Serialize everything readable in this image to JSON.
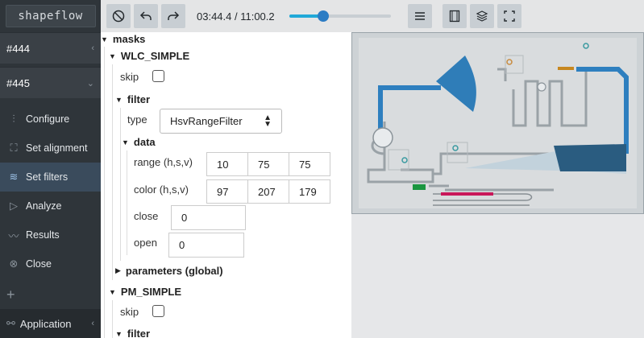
{
  "brand": "shapeflow",
  "feeds": [
    {
      "label": "#444"
    },
    {
      "label": "#445"
    }
  ],
  "nav": [
    {
      "label": "Configure",
      "icon": "sliders-icon"
    },
    {
      "label": "Set alignment",
      "icon": "align-icon"
    },
    {
      "label": "Set filters",
      "icon": "layers-icon",
      "active": true
    },
    {
      "label": "Analyze",
      "icon": "play-icon"
    },
    {
      "label": "Results",
      "icon": "chart-icon"
    },
    {
      "label": "Close",
      "icon": "close-circle-icon"
    }
  ],
  "footer": {
    "label": "Application"
  },
  "toolbar": {
    "time": "03:44.4 / 11:00.2",
    "progress": 0.34,
    "accent": "#20a8d8"
  },
  "masks": {
    "title": "masks",
    "m1": {
      "name": "WLC_SIMPLE",
      "skip_label": "skip",
      "filter_label": "filter",
      "type_label": "type",
      "type_value": "HsvRangeFilter",
      "data_label": "data",
      "range_label": "range (h,s,v)",
      "range": [
        "10",
        "75",
        "75"
      ],
      "color_label": "color (h,s,v)",
      "color": [
        "97",
        "207",
        "179"
      ],
      "close_label": "close",
      "close_value": "0",
      "open_label": "open",
      "open_value": "0",
      "params_label": "parameters (global)"
    },
    "m2": {
      "name": "PM_SIMPLE",
      "skip_label": "skip",
      "filter_label": "filter"
    }
  }
}
